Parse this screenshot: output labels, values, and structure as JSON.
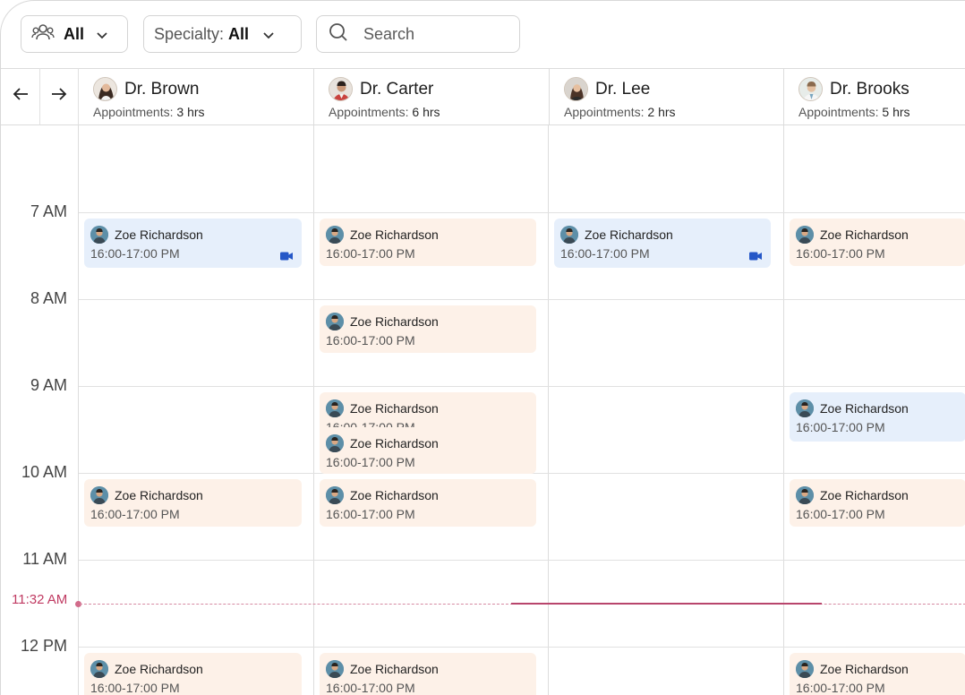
{
  "toolbar": {
    "group_filter": {
      "value": "All",
      "icon": "users-icon"
    },
    "specialty_filter": {
      "label": "Specialty:",
      "value": "All"
    },
    "search": {
      "placeholder": "Search",
      "icon": "search-icon"
    }
  },
  "nav": {
    "prev_icon": "arrow-left-icon",
    "next_icon": "arrow-right-icon"
  },
  "doctors": [
    {
      "name": "Dr. Brown",
      "appt_label": "Appointments:",
      "appt_value": "3 hrs"
    },
    {
      "name": "Dr. Carter",
      "appt_label": "Appointments:",
      "appt_value": "6 hrs"
    },
    {
      "name": "Dr. Lee",
      "appt_label": "Appointments:",
      "appt_value": "2 hrs"
    },
    {
      "name": "Dr. Brooks",
      "appt_label": "Appointments:",
      "appt_value": "5 hrs"
    }
  ],
  "times": [
    "7 AM",
    "8 AM",
    "9 AM",
    "10 AM",
    "11 AM",
    "12 PM"
  ],
  "now_label": "11:32 AM",
  "appointment": {
    "patient": "Zoe Richardson",
    "time": "16:00-17:00 PM"
  },
  "colors": {
    "peach": "#fdf1e8",
    "blue": "#e6effb",
    "now": "#c03a62",
    "video": "#2557c7"
  }
}
